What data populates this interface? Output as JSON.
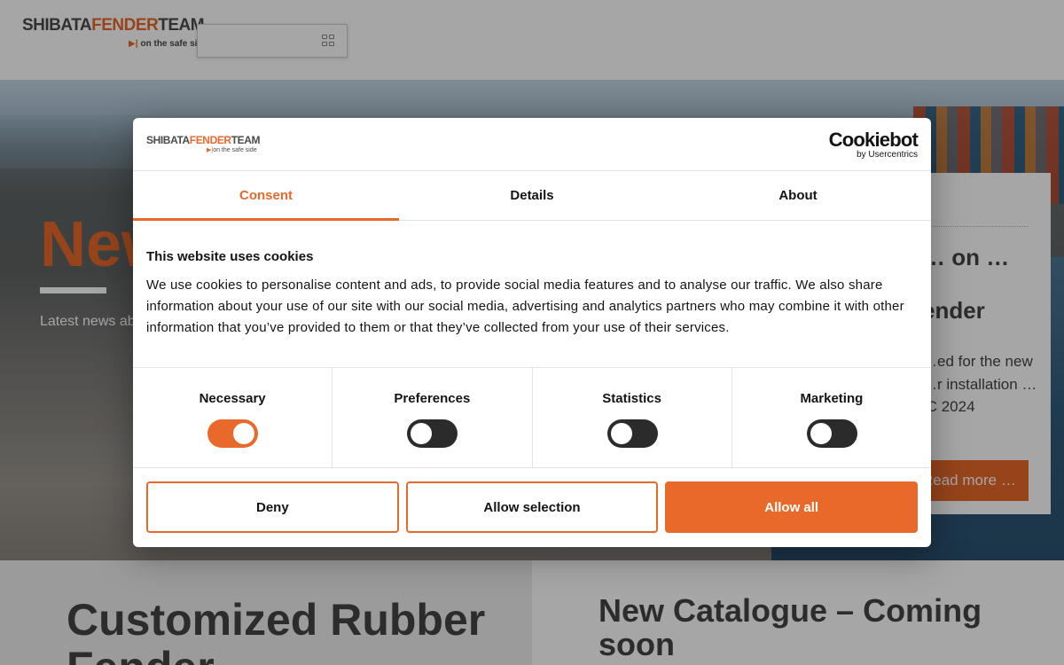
{
  "header": {
    "logo": {
      "part1": "SHIBATA",
      "part2": "FENDER",
      "part3": "TEAM",
      "tagline": "on the safe side"
    },
    "search": {
      "placeholder": ""
    }
  },
  "hero": {
    "title": "News",
    "subtitle": "Latest news about",
    "news_card": {
      "title": "… on … ender",
      "text": "…ed for the new …r installation …IC 2024",
      "read_more": "Read more …"
    }
  },
  "lower": {
    "left_heading": "Customized Rubber Fender",
    "right_heading": "New Catalogue – Coming soon"
  },
  "cookie_dialog": {
    "logo": {
      "part1": "SHIBATA",
      "part2": "FENDER",
      "part3": "TEAM",
      "tagline": "on the safe side"
    },
    "provider": {
      "name": "Cookiebot",
      "by": "by Usercentrics"
    },
    "tabs": [
      {
        "label": "Consent",
        "active": true
      },
      {
        "label": "Details",
        "active": false
      },
      {
        "label": "About",
        "active": false
      }
    ],
    "heading": "This website uses cookies",
    "body": "We use cookies to personalise content and ads, to provide social media features and to analyse our traffic. We also share information about your use of our site with our social media, advertising and analytics partners who may combine it with other information that you’ve provided to them or that they’ve collected from your use of their services.",
    "categories": [
      {
        "label": "Necessary",
        "enabled": true
      },
      {
        "label": "Preferences",
        "enabled": false
      },
      {
        "label": "Statistics",
        "enabled": false
      },
      {
        "label": "Marketing",
        "enabled": false
      }
    ],
    "buttons": {
      "deny": "Deny",
      "allow_selection": "Allow selection",
      "allow_all": "Allow all"
    },
    "accent_color": "#e8692a"
  }
}
